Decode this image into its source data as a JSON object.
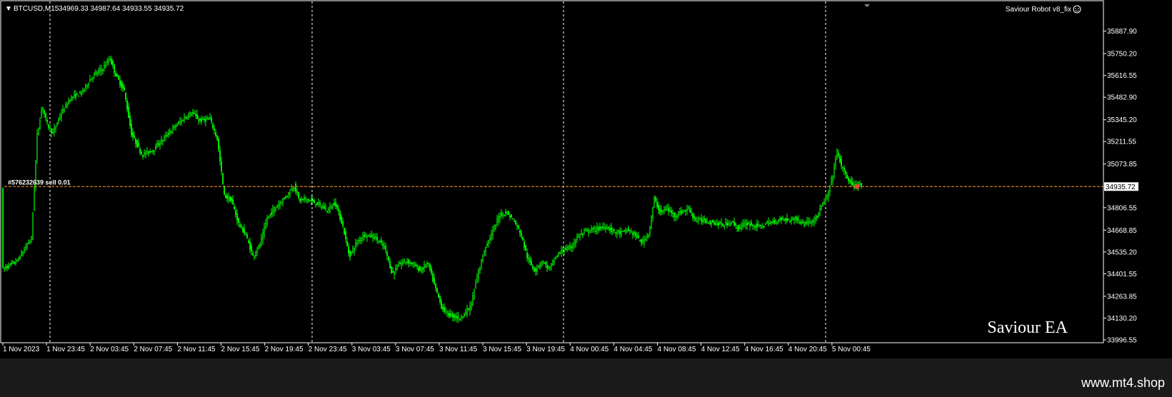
{
  "header": {
    "symbol": "BTCUSD,M15",
    "ohlc": "34969.33 34987.64 34933.55 34935.72",
    "ea_label": "Saviour Robot v8_fix"
  },
  "watermark": "Saviour EA",
  "footer": {
    "site": "www.mt4.shop"
  },
  "order_label": "#576232639 sell 0.01",
  "colors": {
    "background": "#000000",
    "candle": "#00ff00",
    "grid": "#ffffff",
    "price_line": "#ff9c29"
  },
  "chart_data": {
    "type": "candlestick",
    "title": "",
    "xlabel": "",
    "ylabel": "",
    "grid": false,
    "current_price": 34935.72,
    "current_price_label": "34935.72",
    "ylim": [
      33996.55,
      35930
    ],
    "yticks": [
      "35887.90",
      "35750.20",
      "35616.55",
      "35482.90",
      "35345.20",
      "35211.55",
      "35073.85",
      "34806.55",
      "34668.85",
      "34535.20",
      "34401.55",
      "34263.85",
      "34130.20",
      "33996.55"
    ],
    "xticks": [
      "1 Nov 2023",
      "1 Nov 23:45",
      "2 Nov 03:45",
      "2 Nov 07:45",
      "2 Nov 11:45",
      "2 Nov 15:45",
      "2 Nov 19:45",
      "2 Nov 23:45",
      "3 Nov 03:45",
      "3 Nov 07:45",
      "3 Nov 11:45",
      "3 Nov 15:45",
      "3 Nov 19:45",
      "4 Nov 00:45",
      "4 Nov 04:45",
      "4 Nov 08:45",
      "4 Nov 12:45",
      "4 Nov 16:45",
      "4 Nov 20:45",
      "5 Nov 00:45"
    ],
    "day_separators": [
      "2 Nov 00:00",
      "3 Nov 00:00",
      "4 Nov 00:00",
      "5 Nov 00:00"
    ],
    "price_path": [
      [
        0,
        34430
      ],
      [
        20,
        34480
      ],
      [
        40,
        34620
      ],
      [
        48,
        35250
      ],
      [
        55,
        35430
      ],
      [
        62,
        35320
      ],
      [
        70,
        35260
      ],
      [
        80,
        35370
      ],
      [
        95,
        35480
      ],
      [
        110,
        35510
      ],
      [
        125,
        35610
      ],
      [
        140,
        35660
      ],
      [
        150,
        35720
      ],
      [
        158,
        35620
      ],
      [
        170,
        35520
      ],
      [
        180,
        35260
      ],
      [
        195,
        35130
      ],
      [
        210,
        35160
      ],
      [
        225,
        35230
      ],
      [
        240,
        35300
      ],
      [
        255,
        35360
      ],
      [
        265,
        35390
      ],
      [
        275,
        35340
      ],
      [
        290,
        35350
      ],
      [
        300,
        35230
      ],
      [
        310,
        34880
      ],
      [
        320,
        34850
      ],
      [
        330,
        34710
      ],
      [
        340,
        34640
      ],
      [
        350,
        34510
      ],
      [
        360,
        34580
      ],
      [
        370,
        34740
      ],
      [
        380,
        34800
      ],
      [
        395,
        34870
      ],
      [
        408,
        34940
      ],
      [
        415,
        34850
      ],
      [
        425,
        34860
      ],
      [
        440,
        34830
      ],
      [
        455,
        34790
      ],
      [
        465,
        34840
      ],
      [
        475,
        34710
      ],
      [
        485,
        34510
      ],
      [
        495,
        34590
      ],
      [
        505,
        34640
      ],
      [
        520,
        34630
      ],
      [
        535,
        34560
      ],
      [
        545,
        34400
      ],
      [
        555,
        34460
      ],
      [
        565,
        34480
      ],
      [
        575,
        34460
      ],
      [
        585,
        34420
      ],
      [
        595,
        34470
      ],
      [
        605,
        34320
      ],
      [
        615,
        34190
      ],
      [
        625,
        34150
      ],
      [
        640,
        34130
      ],
      [
        655,
        34200
      ],
      [
        665,
        34400
      ],
      [
        675,
        34560
      ],
      [
        685,
        34650
      ],
      [
        695,
        34760
      ],
      [
        705,
        34780
      ],
      [
        715,
        34730
      ],
      [
        725,
        34650
      ],
      [
        735,
        34490
      ],
      [
        745,
        34420
      ],
      [
        755,
        34480
      ],
      [
        765,
        34430
      ],
      [
        775,
        34510
      ],
      [
        785,
        34550
      ],
      [
        795,
        34560
      ],
      [
        805,
        34630
      ],
      [
        815,
        34660
      ],
      [
        825,
        34670
      ],
      [
        835,
        34680
      ],
      [
        845,
        34690
      ],
      [
        855,
        34660
      ],
      [
        865,
        34650
      ],
      [
        875,
        34670
      ],
      [
        885,
        34640
      ],
      [
        895,
        34590
      ],
      [
        905,
        34660
      ],
      [
        912,
        34860
      ],
      [
        920,
        34780
      ],
      [
        930,
        34800
      ],
      [
        940,
        34760
      ],
      [
        950,
        34780
      ],
      [
        960,
        34800
      ],
      [
        970,
        34730
      ],
      [
        980,
        34730
      ],
      [
        990,
        34720
      ],
      [
        1000,
        34710
      ],
      [
        1010,
        34700
      ],
      [
        1020,
        34720
      ],
      [
        1030,
        34680
      ],
      [
        1040,
        34710
      ],
      [
        1050,
        34700
      ],
      [
        1060,
        34690
      ],
      [
        1070,
        34710
      ],
      [
        1080,
        34720
      ],
      [
        1090,
        34740
      ],
      [
        1100,
        34730
      ],
      [
        1110,
        34740
      ],
      [
        1120,
        34710
      ],
      [
        1130,
        34720
      ],
      [
        1140,
        34750
      ],
      [
        1148,
        34830
      ],
      [
        1155,
        34880
      ],
      [
        1162,
        35010
      ],
      [
        1168,
        35150
      ],
      [
        1175,
        35050
      ],
      [
        1182,
        34990
      ],
      [
        1190,
        34940
      ],
      [
        1198,
        34950
      ],
      [
        1205,
        34935.72
      ]
    ]
  }
}
